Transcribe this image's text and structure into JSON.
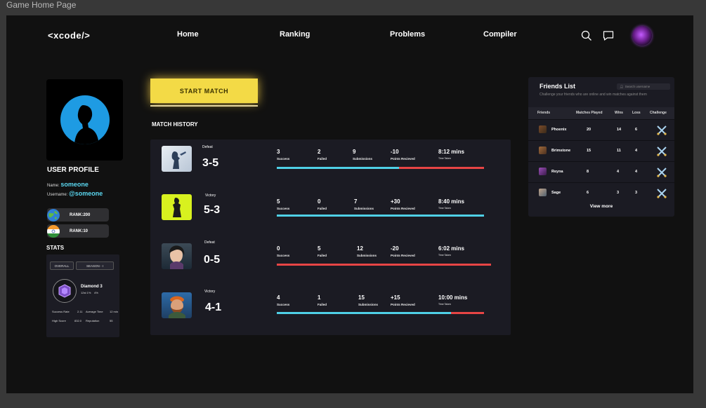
{
  "frame_title": "Game Home Page",
  "nav": {
    "logo": "<xcode/>",
    "items": [
      "Home",
      "Ranking",
      "Problems",
      "Compiler"
    ]
  },
  "profile": {
    "title": "USER PROFILE",
    "name_label": "Name:",
    "name_value": "someone",
    "username_label": "Username:",
    "username_value": "@someone",
    "ranks": [
      "RANK:200",
      "RANK:10"
    ]
  },
  "stats": {
    "title": "STATS",
    "tabs": [
      "OVERALL",
      "SEASON - I"
    ],
    "tier": "Diamond 3",
    "tier_sub_a": "12st 1%",
    "tier_sub_b": "4%",
    "rows": [
      {
        "label": "Success Rate",
        "value": "2.11",
        "label2": "Average Time",
        "value2": "12 min"
      },
      {
        "label": "High Score",
        "value": "832.0",
        "label2": "Reputation",
        "value2": "55"
      }
    ]
  },
  "start_match": "START MATCH",
  "match_history": {
    "title": "MATCH HISTORY",
    "labels": {
      "success": "Success",
      "failed": "Failed",
      "submissions": "Submissions",
      "points": "Points Recieved",
      "time": "Time Taken"
    },
    "matches": [
      {
        "result": "Defeat",
        "score": "3-5",
        "success": "3",
        "failed": "2",
        "submissions": "9",
        "points": "-10",
        "time": "8:12 mins",
        "win_fraction": 0.59
      },
      {
        "result": "Victory",
        "score": "5-3",
        "success": "5",
        "failed": "0",
        "submissions": "7",
        "points": "+30",
        "time": "8:40 mins",
        "win_fraction": 1.0
      },
      {
        "result": "Defeat",
        "score": "0-5",
        "success": "0",
        "failed": "5",
        "submissions": "12",
        "points": "-20",
        "time": "6:02 mins",
        "win_fraction": 0.0
      },
      {
        "result": "Victory",
        "score": "4-1",
        "success": "4",
        "failed": "1",
        "submissions": "15",
        "points": "+15",
        "time": "10:00 mins",
        "win_fraction": 0.84
      }
    ]
  },
  "friends": {
    "title": "Friends List",
    "search_placeholder": "Search username",
    "subtitle": "Challenge your friends who are online and win matches against them",
    "headers": [
      "Friends",
      "Matches Played",
      "Wins",
      "Loss",
      "Challenge"
    ],
    "rows": [
      {
        "name": "Phoenix",
        "matches": "20",
        "wins": "14",
        "loss": "6"
      },
      {
        "name": "Brimstone",
        "matches": "15",
        "wins": "11",
        "loss": "4"
      },
      {
        "name": "Reyna",
        "matches": "8",
        "wins": "4",
        "loss": "4"
      },
      {
        "name": "Sage",
        "matches": "6",
        "wins": "3",
        "loss": "3"
      }
    ],
    "view_more": "View more"
  },
  "colors": {
    "accent_yellow": "#f3da46",
    "bar_success": "#4fd0e6",
    "bar_fail": "#e74545",
    "username_cyan": "#5ad7f0"
  },
  "icons": [
    "search-icon",
    "chat-icon",
    "avatar",
    "globe-icon",
    "india-flag-icon",
    "challenge-swords-icon"
  ]
}
